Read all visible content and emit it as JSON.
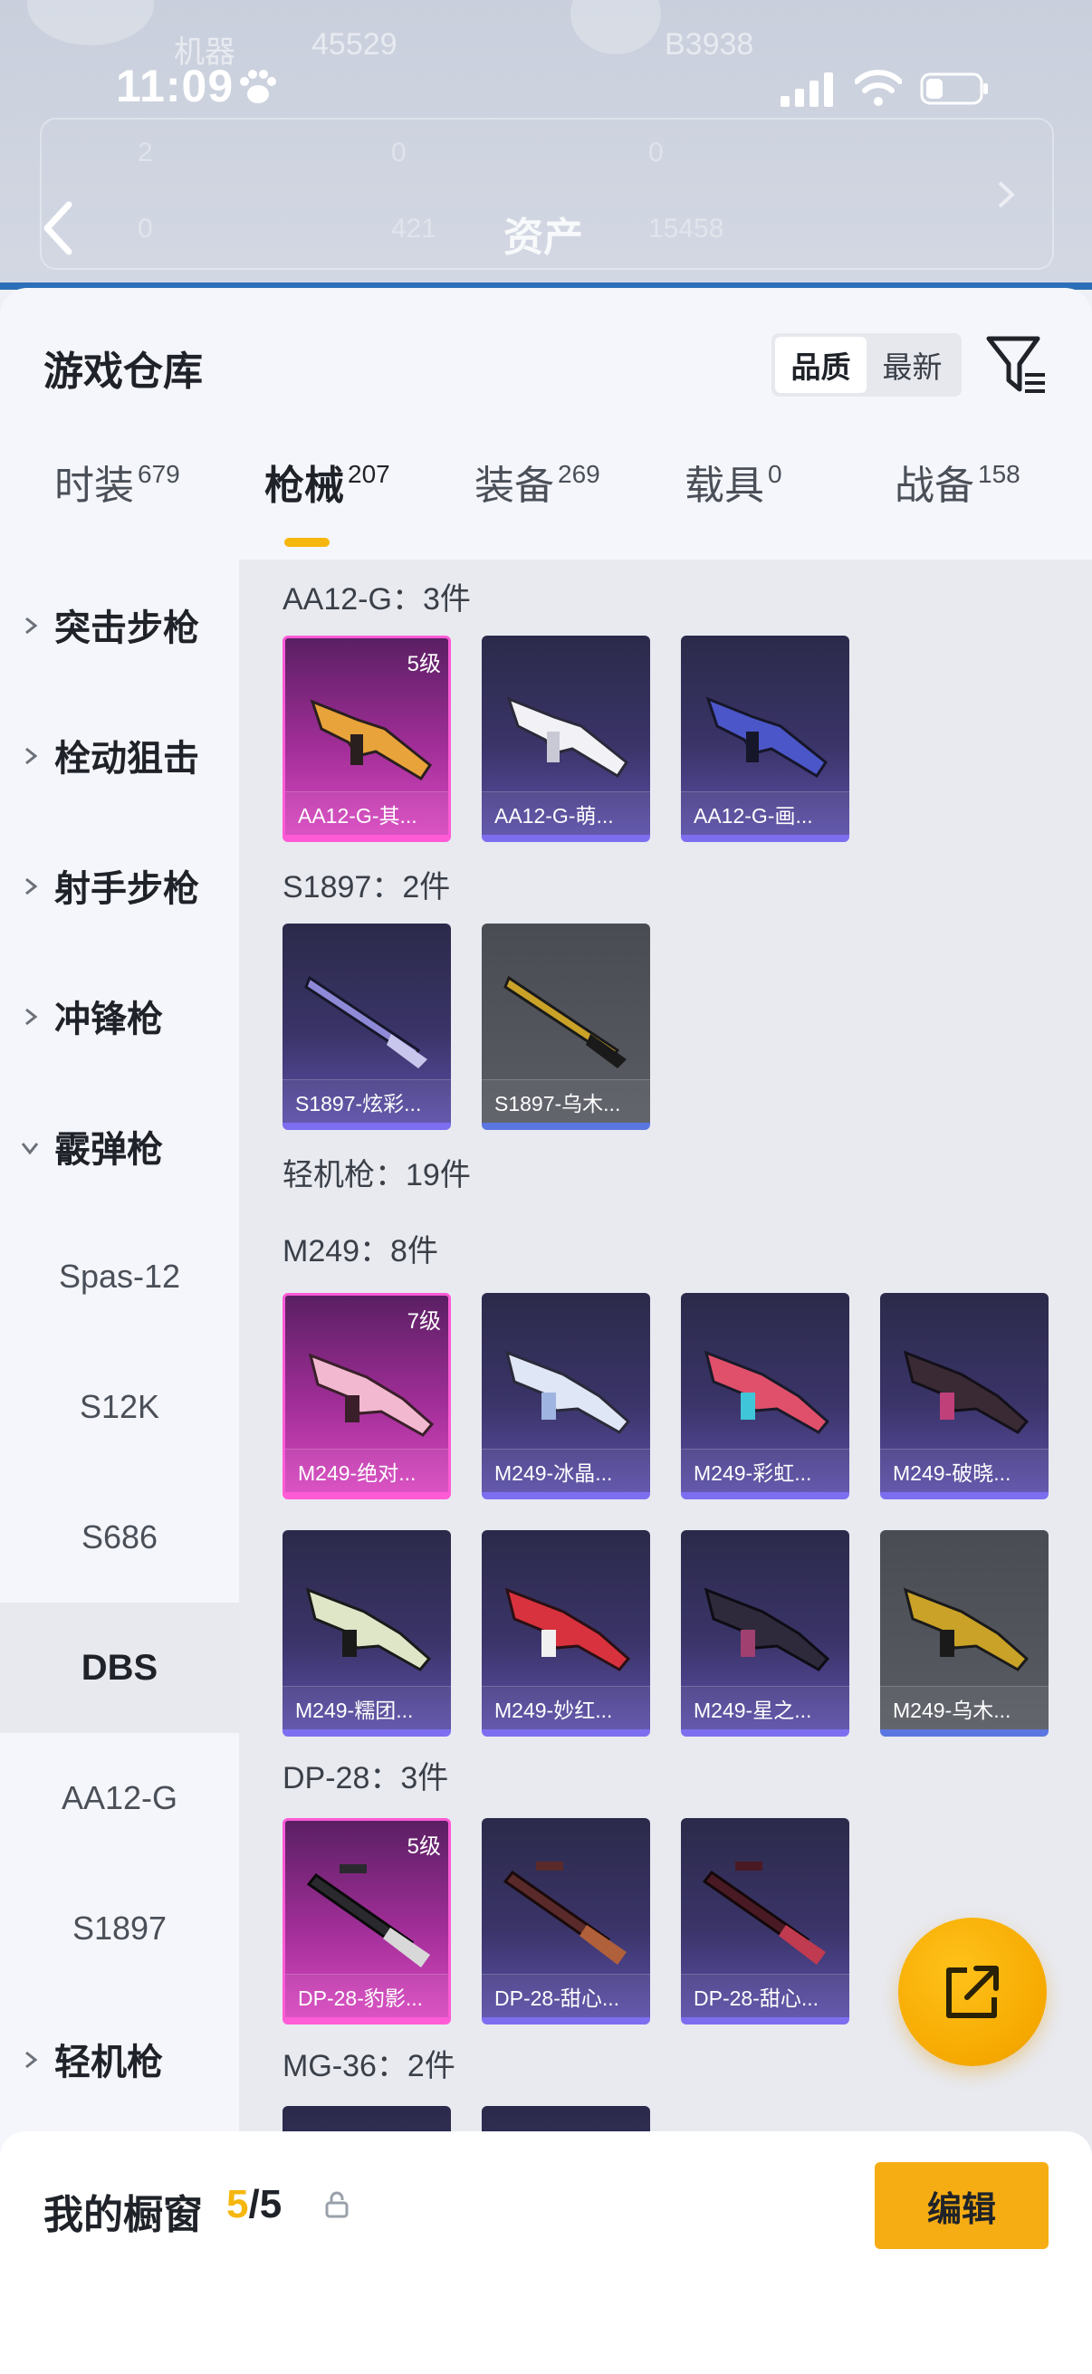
{
  "background": {
    "status_time": "11:09",
    "ghost_texts": [
      "机器",
      "45529",
      "B3938",
      "2",
      "0",
      "0",
      "0",
      "421",
      "15458"
    ],
    "page_title": "资产"
  },
  "sheet": {
    "title": "游戏仓库",
    "sort_options": [
      "品质",
      "最新"
    ],
    "active_sort": "品质"
  },
  "tabs": [
    {
      "label": "时装",
      "count": "679"
    },
    {
      "label": "枪械",
      "count": "207"
    },
    {
      "label": "装备",
      "count": "269"
    },
    {
      "label": "载具",
      "count": "0"
    },
    {
      "label": "战备",
      "count": "158"
    }
  ],
  "active_tab": "枪械",
  "categories": [
    {
      "label": "突击步枪",
      "type": "group",
      "expanded": false
    },
    {
      "label": "栓动狙击",
      "type": "group",
      "expanded": false
    },
    {
      "label": "射手步枪",
      "type": "group",
      "expanded": false
    },
    {
      "label": "冲锋枪",
      "type": "group",
      "expanded": false
    },
    {
      "label": "霰弹枪",
      "type": "group",
      "expanded": true
    },
    {
      "label": "Spas-12",
      "type": "sub"
    },
    {
      "label": "S12K",
      "type": "sub"
    },
    {
      "label": "S686",
      "type": "sub"
    },
    {
      "label": "DBS",
      "type": "sub",
      "selected": true
    },
    {
      "label": "AA12-G",
      "type": "sub"
    },
    {
      "label": "S1897",
      "type": "sub"
    },
    {
      "label": "轻机枪",
      "type": "group",
      "expanded": false
    }
  ],
  "sections": [
    {
      "title": "AA12-G：3件",
      "items": [
        {
          "name": "AA12-G-其...",
          "level": "5级",
          "rarity": "gold"
        },
        {
          "name": "AA12-G-萌...",
          "rarity": "purple"
        },
        {
          "name": "AA12-G-画...",
          "rarity": "purple"
        }
      ]
    },
    {
      "title": "S1897：2件",
      "items": [
        {
          "name": "S1897-炫彩...",
          "rarity": "purple"
        },
        {
          "name": "S1897-乌木...",
          "rarity": "grey"
        }
      ]
    },
    {
      "title": "轻机枪：19件",
      "items": []
    },
    {
      "title": "M249：8件",
      "items": [
        {
          "name": "M249-绝对...",
          "level": "7级",
          "rarity": "gold"
        },
        {
          "name": "M249-冰晶...",
          "rarity": "purple"
        },
        {
          "name": "M249-彩虹...",
          "rarity": "purple"
        },
        {
          "name": "M249-破晓...",
          "rarity": "purple"
        },
        {
          "name": "M249-糯团...",
          "rarity": "purple"
        },
        {
          "name": "M249-妙红...",
          "rarity": "purple"
        },
        {
          "name": "M249-星之...",
          "rarity": "purple"
        },
        {
          "name": "M249-乌木...",
          "rarity": "grey"
        }
      ]
    },
    {
      "title": "DP-28：3件",
      "items": [
        {
          "name": "DP-28-豹影...",
          "level": "5级",
          "rarity": "gold"
        },
        {
          "name": "DP-28-甜心...",
          "rarity": "purple"
        },
        {
          "name": "DP-28-甜心...",
          "rarity": "purple"
        }
      ]
    },
    {
      "title": "MG-36：2件",
      "items": [
        {
          "name": "",
          "rarity": "purple"
        },
        {
          "name": "",
          "rarity": "purple"
        }
      ]
    }
  ],
  "showcase": {
    "label": "我的橱窗",
    "filled": "5",
    "separator": "/",
    "total": "5",
    "edit_label": "编辑"
  },
  "colors": {
    "accent": "#f5b70e",
    "gold_rarity": "#d949c0",
    "purple_rarity": "#5b4fa8",
    "grey_rarity": "#5a5c64"
  },
  "icons": [
    "paw-icon",
    "signal-icon",
    "wifi-icon",
    "battery-icon",
    "back-arrow-icon",
    "filter-icon",
    "chevron-right-icon",
    "chevron-down-icon",
    "share-icon",
    "lock-icon"
  ]
}
